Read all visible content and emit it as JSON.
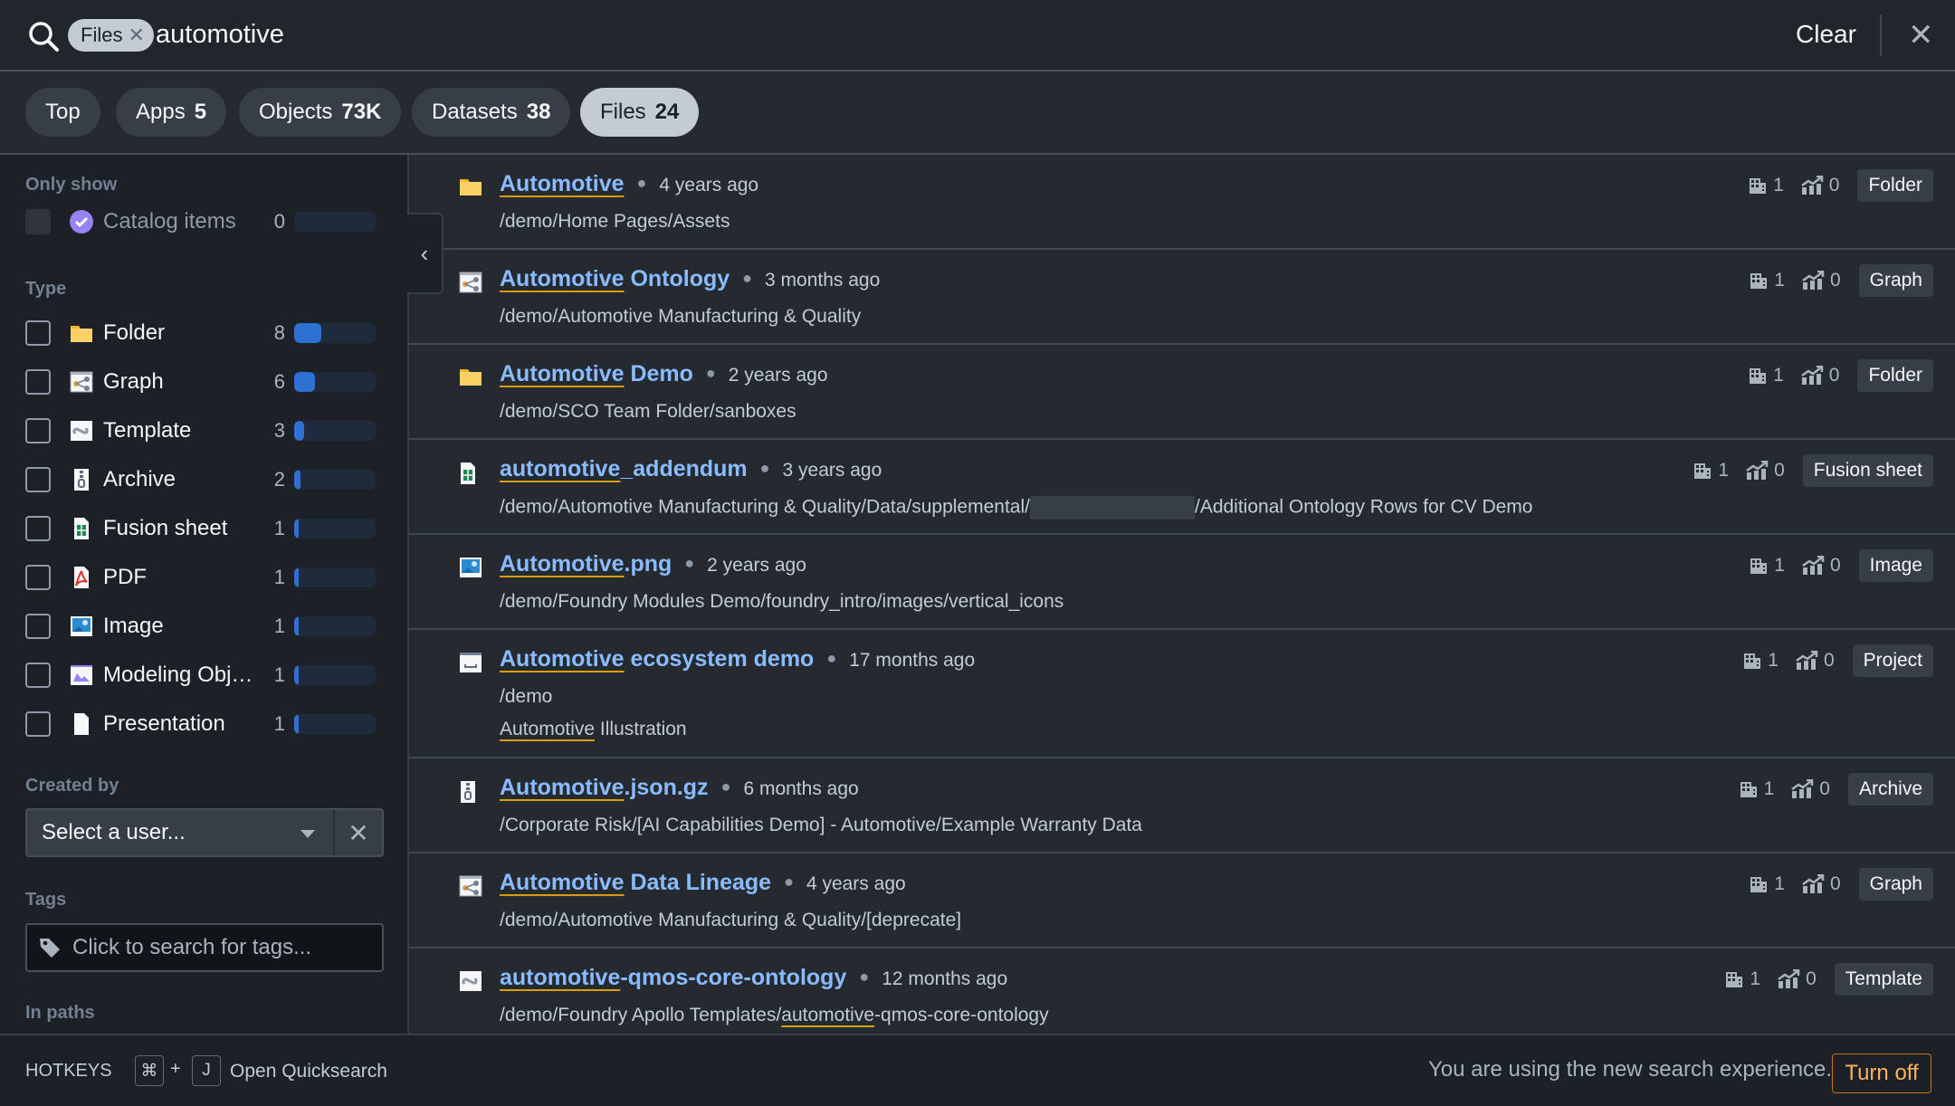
{
  "search": {
    "filter_chip": "Files",
    "query": "automotive",
    "clear_label": "Clear"
  },
  "tabs": [
    {
      "label": "Top",
      "count": ""
    },
    {
      "label": "Apps",
      "count": "5"
    },
    {
      "label": "Objects",
      "count": "73K"
    },
    {
      "label": "Datasets",
      "count": "38"
    },
    {
      "label": "Files",
      "count": "24",
      "active": true
    }
  ],
  "sidebar": {
    "only_show_label": "Only show",
    "catalog": {
      "label": "Catalog items",
      "count": "0",
      "fraction": 0
    },
    "type_label": "Type",
    "types": [
      {
        "label": "Folder",
        "icon": "folder-icon",
        "count": "8",
        "fraction": 0.33
      },
      {
        "label": "Graph",
        "icon": "graph-icon",
        "count": "6",
        "fraction": 0.25
      },
      {
        "label": "Template",
        "icon": "template-icon",
        "count": "3",
        "fraction": 0.125
      },
      {
        "label": "Archive",
        "icon": "archive-icon",
        "count": "2",
        "fraction": 0.083
      },
      {
        "label": "Fusion sheet",
        "icon": "fusion-sheet-icon",
        "count": "1",
        "fraction": 0.042
      },
      {
        "label": "PDF",
        "icon": "pdf-icon",
        "count": "1",
        "fraction": 0.042
      },
      {
        "label": "Image",
        "icon": "image-icon",
        "count": "1",
        "fraction": 0.042
      },
      {
        "label": "Modeling Obje…",
        "icon": "modeling-objective-icon",
        "count": "1",
        "fraction": 0.042
      },
      {
        "label": "Presentation",
        "icon": "presentation-icon",
        "count": "1",
        "fraction": 0.042
      }
    ],
    "created_by_label": "Created by",
    "user_select_placeholder": "Select a user...",
    "tags_label": "Tags",
    "tags_placeholder": "Click to search for tags...",
    "in_paths_label": "In paths"
  },
  "results": [
    {
      "icon": "folder-icon",
      "title_hl": "Automotive",
      "title_rest": "",
      "time": "4 years ago",
      "path": "/demo/Home Pages/Assets",
      "views_org": "1",
      "views_trend": "0",
      "badge": "Folder"
    },
    {
      "icon": "graph-icon",
      "title_hl": "Automotive",
      "title_rest": " Ontology",
      "time": "3 months ago",
      "path": "/demo/Automotive Manufacturing & Quality",
      "views_org": "1",
      "views_trend": "0",
      "badge": "Graph"
    },
    {
      "icon": "folder-icon",
      "title_hl": "Automotive",
      "title_rest": " Demo",
      "time": "2 years ago",
      "path": "/demo/SCO Team Folder/sanboxes",
      "views_org": "1",
      "views_trend": "0",
      "badge": "Folder"
    },
    {
      "icon": "fusion-sheet-icon",
      "title_hl": "automotive",
      "title_rest": "_addendum",
      "time": "3 years ago",
      "path": "/demo/Automotive Manufacturing & Quality/Data/supplemental/",
      "path_after_redact": "/Additional Ontology Rows for CV Demo",
      "views_org": "1",
      "views_trend": "0",
      "badge": "Fusion sheet"
    },
    {
      "icon": "image-icon",
      "title_hl": "Automotive",
      "title_rest": ".png",
      "time": "2 years ago",
      "path": "/demo/Foundry Modules Demo/foundry_intro/images/vertical_icons",
      "views_org": "1",
      "views_trend": "0",
      "badge": "Image"
    },
    {
      "icon": "project-icon",
      "title_hl": "Automotive",
      "title_rest": " ecosystem demo",
      "time": "17 months ago",
      "path": "/demo",
      "desc_hl": "Automotive",
      "desc_rest": " Illustration",
      "views_org": "1",
      "views_trend": "0",
      "badge": "Project"
    },
    {
      "icon": "archive-icon",
      "title_hl": "Automotive",
      "title_rest": ".json.gz",
      "time": "6 months ago",
      "path": "/Corporate Risk/[AI Capabilities Demo] - Automotive/Example Warranty Data",
      "views_org": "1",
      "views_trend": "0",
      "badge": "Archive"
    },
    {
      "icon": "graph-icon",
      "title_hl": "Automotive",
      "title_rest": " Data Lineage",
      "time": "4 years ago",
      "path": "/demo/Automotive Manufacturing & Quality/[deprecate]",
      "views_org": "1",
      "views_trend": "0",
      "badge": "Graph"
    },
    {
      "icon": "template-icon",
      "title_hl": "automotive",
      "title_rest": "-qmos-core-ontology",
      "time": "12 months ago",
      "path": "/demo/Foundry Apollo Templates/",
      "path_hl": "automotive",
      "path_rest": "-qmos-core-ontology",
      "views_org": "1",
      "views_trend": "0",
      "badge": "Template"
    }
  ],
  "footer": {
    "hotkeys_label": "HOTKEYS",
    "key1": "⌘",
    "plus": "+",
    "key2": "J",
    "hotkey_action": "Open Quicksearch",
    "notice": "You are using the new search experience.",
    "turn_off_label": "Turn off"
  },
  "colors": {
    "link": "#8abbff",
    "highlight_underline": "#d99e0b",
    "bar_fill": "#2d72d2",
    "turn_off": "#fbb360"
  }
}
